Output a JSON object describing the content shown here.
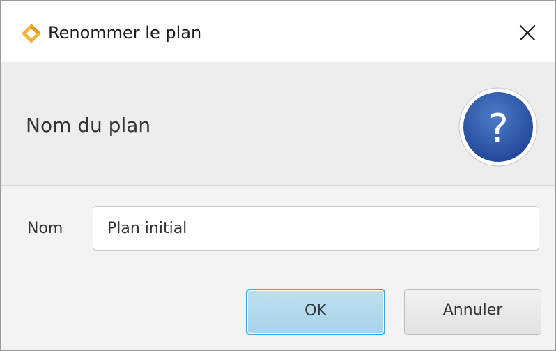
{
  "window": {
    "title": "Renommer le plan",
    "app_icon": "diamond-logo-icon",
    "close_icon": "close-icon"
  },
  "header": {
    "text": "Nom du plan",
    "icon": "question-mark-icon",
    "icon_glyph": "?"
  },
  "form": {
    "name_label": "Nom",
    "name_value": "Plan initial"
  },
  "buttons": {
    "ok_label": "OK",
    "cancel_label": "Annuler"
  },
  "colors": {
    "accent_logo": "#f0a92c",
    "help_icon_fill": "#2f5fae",
    "ok_border": "#3fa6d9"
  }
}
